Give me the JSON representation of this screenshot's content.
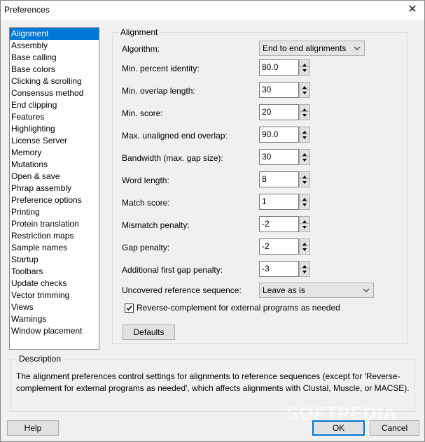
{
  "window": {
    "title": "Preferences",
    "close_symbol": "✕"
  },
  "sidebar": {
    "items": [
      {
        "label": "Alignment",
        "selected": true
      },
      {
        "label": "Assembly"
      },
      {
        "label": "Base calling"
      },
      {
        "label": "Base colors"
      },
      {
        "label": "Clicking & scrolling"
      },
      {
        "label": "Consensus method"
      },
      {
        "label": "End clipping"
      },
      {
        "label": "Features"
      },
      {
        "label": "Highlighting"
      },
      {
        "label": "License Server"
      },
      {
        "label": "Memory"
      },
      {
        "label": "Mutations"
      },
      {
        "label": "Open & save"
      },
      {
        "label": "Phrap assembly"
      },
      {
        "label": "Preference options"
      },
      {
        "label": "Printing"
      },
      {
        "label": "Protein translation"
      },
      {
        "label": "Restriction maps"
      },
      {
        "label": "Sample names"
      },
      {
        "label": "Startup"
      },
      {
        "label": "Toolbars"
      },
      {
        "label": "Update checks"
      },
      {
        "label": "Vector trimming"
      },
      {
        "label": "Views"
      },
      {
        "label": "Warnings"
      },
      {
        "label": "Window placement"
      }
    ]
  },
  "alignment": {
    "group_title": "Alignment",
    "algorithm": {
      "label": "Algorithm:",
      "value": "End to end alignments"
    },
    "fields": [
      {
        "label": "Min. percent identity:",
        "value": "80.0"
      },
      {
        "label": "Min. overlap length:",
        "value": "30"
      },
      {
        "label": "Min. score:",
        "value": "20"
      },
      {
        "label": "Max. unaligned end overlap:",
        "value": "90.0"
      },
      {
        "label": "Bandwidth (max. gap size):",
        "value": "30"
      },
      {
        "label": "Word length:",
        "value": "8"
      },
      {
        "label": "Match score:",
        "value": "1"
      },
      {
        "label": "Mismatch penalty:",
        "value": "-2"
      },
      {
        "label": "Gap penalty:",
        "value": "-2"
      },
      {
        "label": "Additional first gap penalty:",
        "value": "-3"
      }
    ],
    "uncovered": {
      "label": "Uncovered reference sequence:",
      "value": "Leave as is"
    },
    "reverse_complement": {
      "label": "Reverse-complement for external programs as needed",
      "checked": true
    },
    "defaults_label": "Defaults"
  },
  "description": {
    "title": "Description",
    "text": "The alignment preferences control settings for alignments to reference sequences (except for 'Reverse-complement for external programs as needed', which affects alignments with Clustal, Muscle, or MACSE)."
  },
  "footer": {
    "help_label": "Help",
    "ok_label": "OK",
    "cancel_label": "Cancel"
  },
  "watermark": "SOFTPEDIA",
  "colors": {
    "selection": "#0078d7",
    "window_bg": "#f0f0f0"
  },
  "icons": {
    "close": "close-icon",
    "checkbox": "checkmark-icon",
    "dropdown": "chevron-down-icon",
    "spin_up": "arrow-up-icon",
    "spin_down": "arrow-down-icon"
  }
}
